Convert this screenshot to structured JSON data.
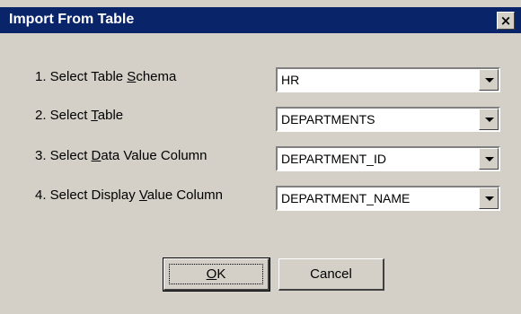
{
  "dialog": {
    "title": "Import From Table",
    "close_glyph": "×"
  },
  "rows": [
    {
      "label_pre": "1. Select Table ",
      "mnemonic": "S",
      "label_post": "chema",
      "value": "HR"
    },
    {
      "label_pre": "2. Select ",
      "mnemonic": "T",
      "label_post": "able",
      "value": "DEPARTMENTS"
    },
    {
      "label_pre": "3. Select ",
      "mnemonic": "D",
      "label_post": "ata Value Column",
      "value": "DEPARTMENT_ID"
    },
    {
      "label_pre": "4. Select Display ",
      "mnemonic": "V",
      "label_post": "alue Column",
      "value": "DEPARTMENT_NAME"
    }
  ],
  "buttons": {
    "ok_mnemonic": "O",
    "ok_rest": "K",
    "cancel_label": "Cancel"
  },
  "colors": {
    "titlebar": "#0a246a",
    "dialog_bg": "#d4d0c8"
  },
  "icons": {
    "close": "close-icon",
    "dropdown": "chevron-down-icon"
  }
}
